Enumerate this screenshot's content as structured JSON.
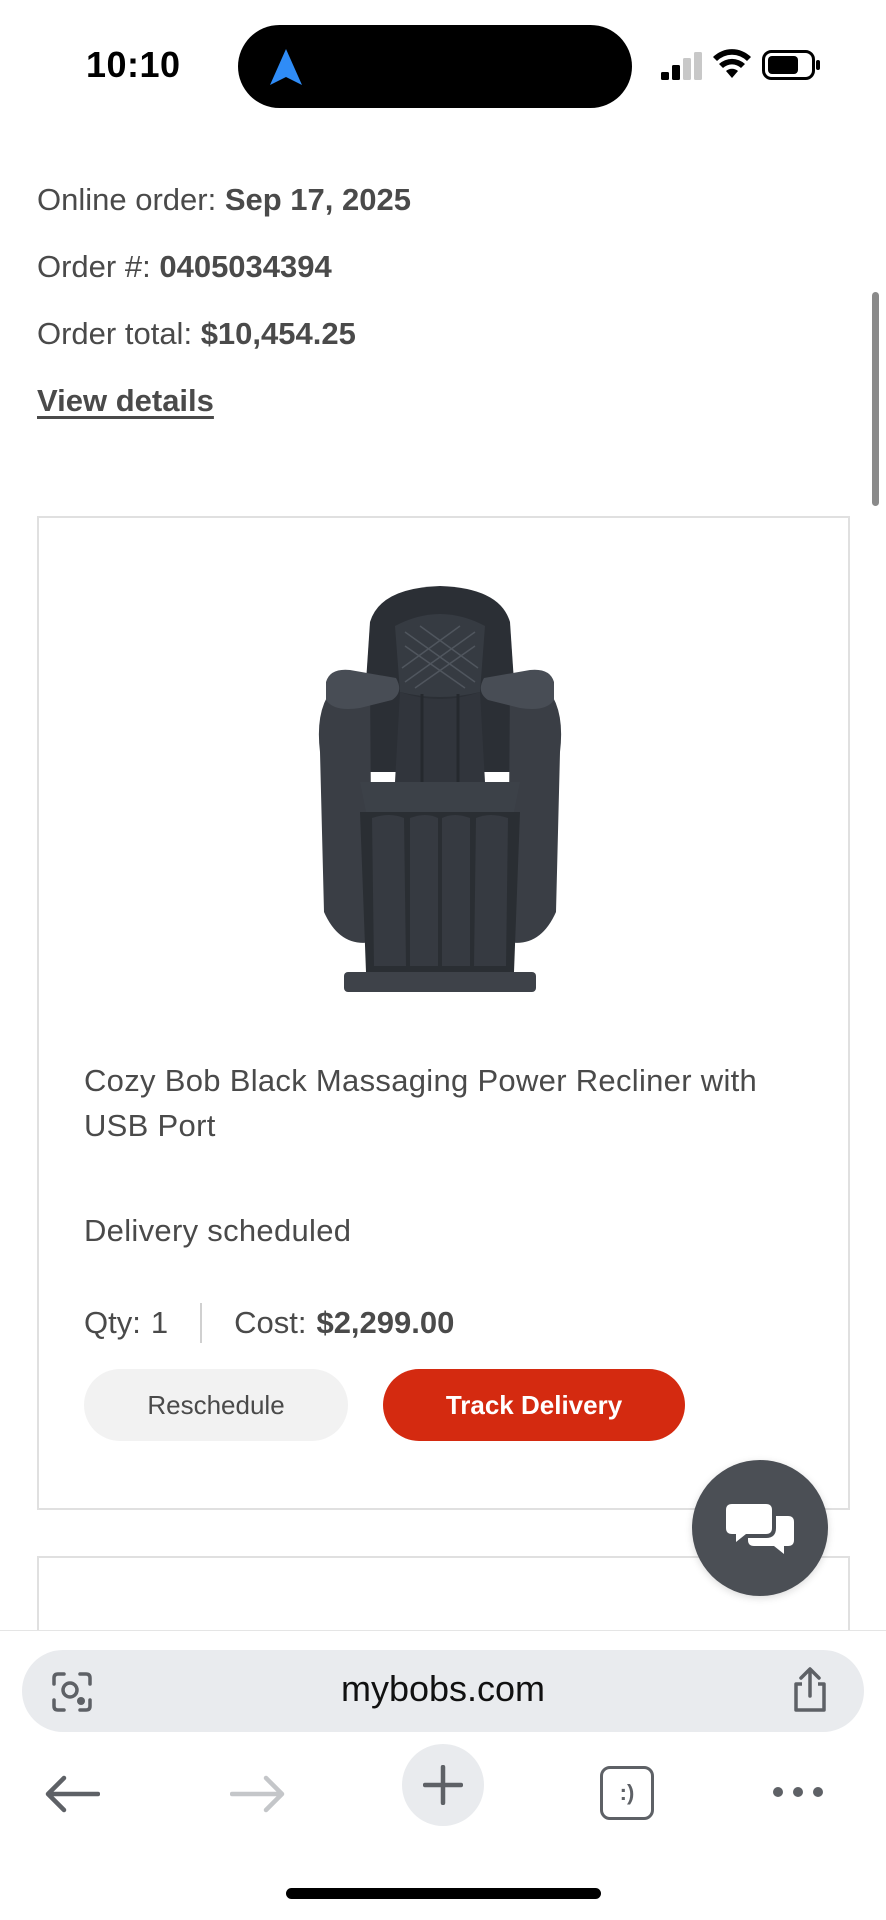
{
  "status_bar": {
    "time": "10:10"
  },
  "order": {
    "date_label": "Online order:",
    "date_value": "Sep 17, 2025",
    "number_label": "Order #:",
    "number_value": "0405034394",
    "total_label": "Order total:",
    "total_value": "$10,454.25",
    "view_details": "View details"
  },
  "item": {
    "name": "Cozy Bob Black Massaging Power Recliner with USB Port",
    "status": "Delivery scheduled",
    "qty_label": "Qty:",
    "qty_value": "1",
    "cost_label": "Cost:",
    "cost_value": "$2,299.00",
    "reschedule_label": "Reschedule",
    "track_label": "Track Delivery"
  },
  "browser": {
    "url": "mybobs.com",
    "tabs_glyph": ":)"
  },
  "colors": {
    "accent": "#d42a10",
    "text": "#4a4a4a",
    "chat_fab": "#4b4f55"
  },
  "icons": {
    "navigation": "location-arrow-icon",
    "chat": "chat-bubbles-icon",
    "lens": "visual-search-icon",
    "share": "share-icon",
    "back": "arrow-left-icon",
    "forward": "arrow-right-icon",
    "new_tab": "plus-icon",
    "more": "ellipsis-icon"
  }
}
